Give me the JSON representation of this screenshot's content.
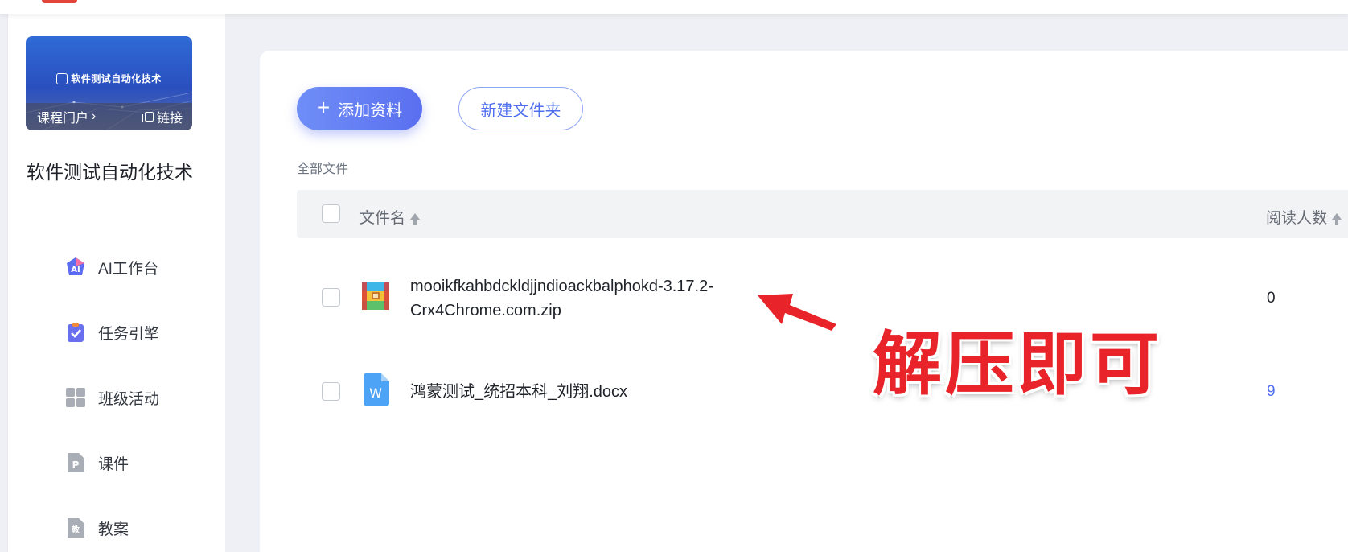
{
  "sidebar": {
    "cover": {
      "title": "软件测试自动化技术",
      "portal_label": "课程门户",
      "link_label": "链接"
    },
    "course_name": "软件测试自动化技术",
    "nav": [
      {
        "label": "AI工作台",
        "icon": "ai-workbench-icon"
      },
      {
        "label": "任务引擎",
        "icon": "task-clipboard-icon"
      },
      {
        "label": "班级活动",
        "icon": "grid-icon"
      },
      {
        "label": "课件",
        "icon": "ppt-file-icon"
      },
      {
        "label": "教案",
        "icon": "lesson-plan-icon"
      }
    ]
  },
  "toolbar": {
    "add_label": "添加资料",
    "new_folder_label": "新建文件夹"
  },
  "breadcrumb": "全部文件",
  "table": {
    "columns": {
      "name": "文件名",
      "readers": "阅读人数"
    },
    "rows": [
      {
        "name_line1": "mooikfkahbdckldjjndioackbalphokd-3.17.2-",
        "name_line2": "Crx4Chrome.com.zip",
        "readers": "0",
        "type": "zip"
      },
      {
        "name": "鸿蒙测试_统招本科_刘翔.docx",
        "readers": "9",
        "type": "docx"
      }
    ]
  },
  "annotation": {
    "text": "解压即可",
    "color": "#e8242a"
  },
  "colors": {
    "accent": "#5a6ff0",
    "link_count": "#4f6ff0"
  }
}
